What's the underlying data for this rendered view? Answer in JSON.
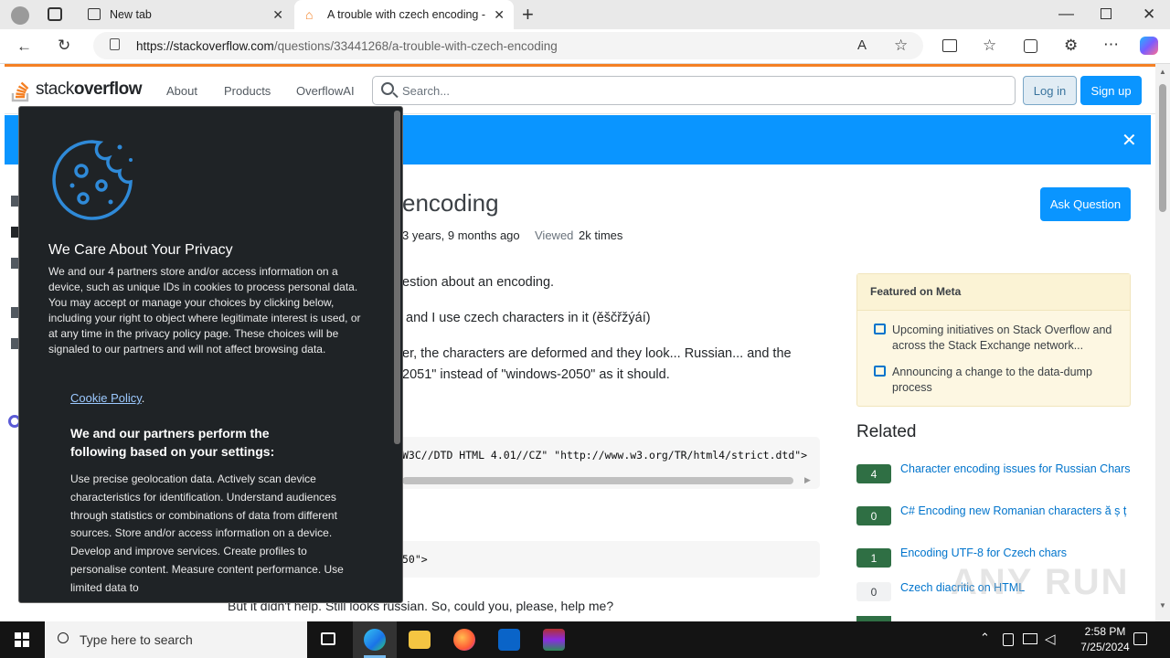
{
  "browser": {
    "tabs": [
      {
        "label": "New tab",
        "active": false
      },
      {
        "label": "A trouble with czech encoding -",
        "active": true
      }
    ],
    "url_domain": "https://stackoverflow.com",
    "url_path": "/questions/33441268/a-trouble-with-czech-encoding"
  },
  "header": {
    "logo_text_stack": "stack",
    "logo_text_overflow": "overflow",
    "nav": [
      "About",
      "Products",
      "OverflowAI"
    ],
    "search_placeholder": "Search...",
    "login": "Log in",
    "signup": "Sign up"
  },
  "question": {
    "title_fragment": "encoding",
    "ask_button": "Ask Question",
    "modified_fragment": "3 years, 9 months ago",
    "viewed_label": "Viewed",
    "viewed_value": "2k times",
    "lines": [
      "estion about an encoding.",
      "and I use czech characters in it (ěščřžýáí)",
      "er, the characters are deformed and they look... Russian... and the",
      "2051\" instead of \"windows-2050\" as it should."
    ],
    "code1": "W3C//DTD HTML 4.01//CZ\" \"http://www.w3.org/TR/html4/strict.dtd\">",
    "code2": "50\">",
    "last_line": "But it didn't help. Still looks russian. So, could you, please, help me?"
  },
  "sidebar": {
    "meta_title": "Featured on Meta",
    "meta_items": [
      "Upcoming initiatives on Stack Overflow and across the Stack Exchange network...",
      "Announcing a change to the data-dump process"
    ],
    "related_title": "Related",
    "related": [
      {
        "score": "4",
        "title": "Character encoding issues for Russian Chars",
        "answered": true
      },
      {
        "score": "0",
        "title": "C# Encoding new Romanian characters ă ș ț",
        "answered": true
      },
      {
        "score": "1",
        "title": "Encoding UTF-8 for Czech chars",
        "answered": true
      },
      {
        "score": "0",
        "title": "Czech diacritic on HTML",
        "answered": false
      }
    ]
  },
  "cookie": {
    "heading": "We Care About Your Privacy",
    "paragraph": "We and our 4 partners store and/or access information on a device, such as unique IDs in cookies to process personal data. You may accept or manage your choices by clicking below, including your right to object where legitimate interest is used, or at any time in the privacy policy page. These choices will be signaled to our partners and will not affect browsing data.",
    "policy_link": "Cookie Policy",
    "policy_suffix": ".",
    "subheading": "We and our partners perform the following based on your settings:",
    "purposes": "Use precise geolocation data. Actively scan device characteristics for identification. Understand audiences through statistics or combinations of data from different sources. Store and/or access information on a device. Develop and improve services. Create profiles to personalise content. Measure content performance. Use limited data to"
  },
  "taskbar": {
    "search_placeholder": "Type here to search",
    "time": "2:58 PM",
    "date": "7/25/2024"
  },
  "watermark": "ANY RUN",
  "colors": {
    "so_blue": "#0a95ff",
    "so_orange": "#f48024",
    "link_blue": "#0074cc",
    "answered_green": "#2f6f44",
    "cookie_bg": "#1f2326"
  }
}
